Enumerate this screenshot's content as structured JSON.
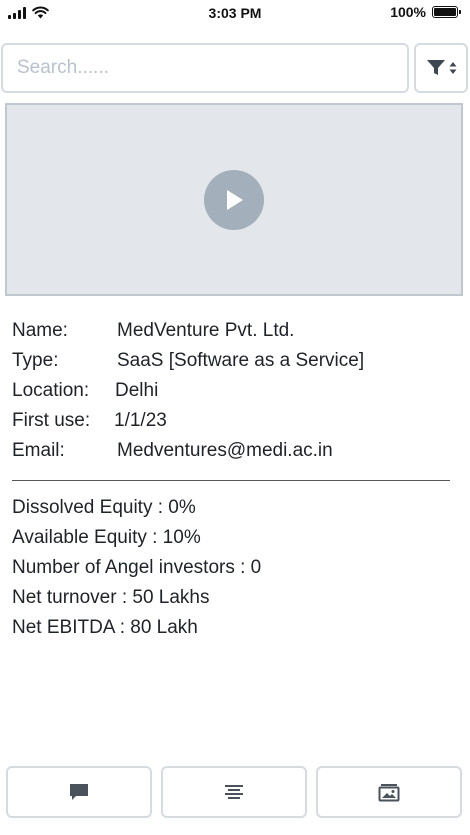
{
  "status_bar": {
    "time": "3:03 PM",
    "battery": "100%"
  },
  "search": {
    "placeholder": "Search......",
    "value": ""
  },
  "filter": {
    "icon": "filter-sort-icon"
  },
  "video": {
    "icon": "play-icon"
  },
  "details": [
    {
      "label": "Name:",
      "value": "MedVenture Pvt. Ltd."
    },
    {
      "label": "Type:",
      "value": "SaaS [Software as a Service]"
    },
    {
      "label": "Location:",
      "value": "Delhi"
    },
    {
      "label": "First use:",
      "value": "1/1/23"
    },
    {
      "label": "Email:",
      "value": "Medventures@medi.ac.in"
    }
  ],
  "metrics": [
    "Dissolved Equity : 0%",
    "Available Equity : 10%",
    "Number of Angel investors : 0",
    "Net turnover : 50 Lakhs",
    "Net EBITDA : 80 Lakh"
  ],
  "bottom_bar": {
    "buttons": [
      "comment-icon",
      "text-align-icon",
      "image-icon"
    ]
  }
}
